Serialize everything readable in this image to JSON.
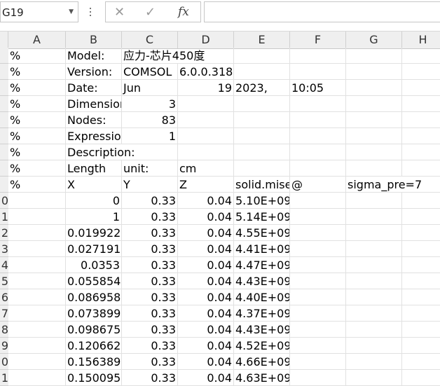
{
  "name_box": "G19",
  "fx_label": "fx",
  "cancel_glyph": "✕",
  "confirm_glyph": "✓",
  "columns": [
    "A",
    "B",
    "C",
    "D",
    "E",
    "F",
    "G",
    "H"
  ],
  "row_headers": [
    "",
    "",
    "",
    "",
    "",
    "",
    "",
    "",
    "",
    "0",
    "1",
    "2",
    "3",
    "4",
    "5",
    "6",
    "7",
    "8",
    "9",
    "0",
    "1"
  ],
  "rows": [
    {
      "A": "%",
      "B": "Model:",
      "C": "应力-芯片450度"
    },
    {
      "A": "%",
      "B": "Version:",
      "C": "COMSOL",
      "D": "6.0.0.318"
    },
    {
      "A": "%",
      "B": "Date:",
      "C": "Jun",
      "D": "19",
      "E": "2023,",
      "F": "10:05"
    },
    {
      "A": "%",
      "B": "Dimension",
      "C": "3"
    },
    {
      "A": "%",
      "B": "Nodes:",
      "C": "83"
    },
    {
      "A": "%",
      "B": "Expression",
      "C": "1"
    },
    {
      "A": "%",
      "B": "Description:"
    },
    {
      "A": "%",
      "B": "Length",
      "C": "unit:",
      "D": "cm"
    },
    {
      "A": "%",
      "B": "X",
      "C": "Y",
      "D": "Z",
      "E": "solid.mises",
      "F": "@",
      "G": "sigma_pre=7"
    },
    {
      "B": "0",
      "C": "0.33",
      "D": "0.04",
      "E": "5.10E+09"
    },
    {
      "B": "1",
      "C": "0.33",
      "D": "0.04",
      "E": "5.14E+09"
    },
    {
      "B": "0.019922",
      "C": "0.33",
      "D": "0.04",
      "E": "4.55E+09"
    },
    {
      "B": "0.027191",
      "C": "0.33",
      "D": "0.04",
      "E": "4.41E+09"
    },
    {
      "B": "0.0353",
      "C": "0.33",
      "D": "0.04",
      "E": "4.47E+09"
    },
    {
      "B": "0.055854",
      "C": "0.33",
      "D": "0.04",
      "E": "4.43E+09"
    },
    {
      "B": "0.086958",
      "C": "0.33",
      "D": "0.04",
      "E": "4.40E+09"
    },
    {
      "B": "0.073899",
      "C": "0.33",
      "D": "0.04",
      "E": "4.37E+09"
    },
    {
      "B": "0.098675",
      "C": "0.33",
      "D": "0.04",
      "E": "4.43E+09"
    },
    {
      "B": "0.120662",
      "C": "0.33",
      "D": "0.04",
      "E": "4.52E+09"
    },
    {
      "B": "0.156389",
      "C": "0.33",
      "D": "0.04",
      "E": "4.66E+09"
    },
    {
      "B": "0.150095",
      "C": "0.33",
      "D": "0.04",
      "E": "4.63E+09"
    }
  ]
}
